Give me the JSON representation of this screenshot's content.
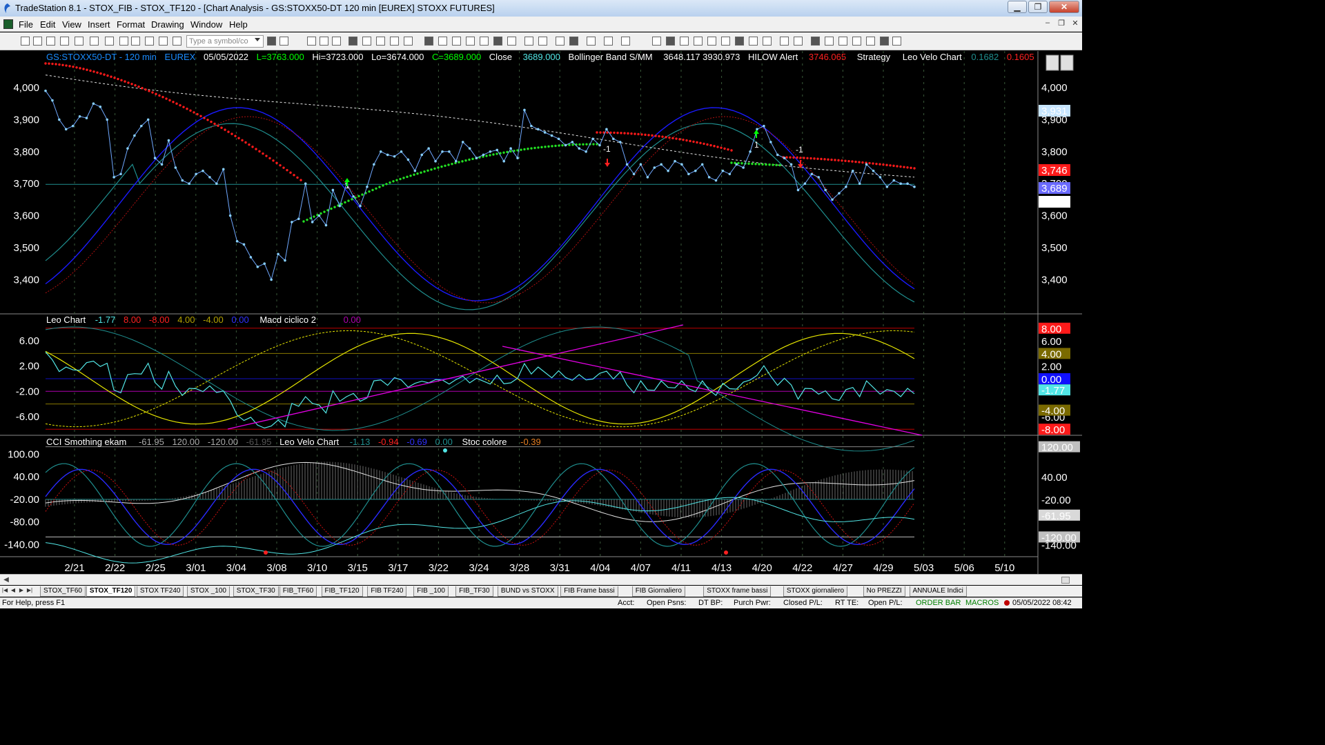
{
  "window": {
    "title": "TradeStation 8.1 - STOX_FIB - STOX_TF120 - [Chart Analysis - GS:STOXX50-DT  120 min  [EUREX] STOXX FUTURES]"
  },
  "menu": {
    "items": [
      "File",
      "Edit",
      "View",
      "Insert",
      "Format",
      "Drawing",
      "Window",
      "Help"
    ]
  },
  "toolbar": {
    "symbol_placeholder": "Type a symbol/co"
  },
  "header": {
    "symbol": "GS:STOXX50-DT - 120 min",
    "exchange": "EUREX",
    "date": "05/05/2022",
    "low_lbl": "L=3763.000",
    "hi": "Hi=3723.000",
    "lo": "Lo=3674.000",
    "close_val": "C=3689.000",
    "close_word": "Close",
    "close_num": "3689.000",
    "bb_name": "Bollinger Band S/MM",
    "bb_vals": "3648.117  3930.973",
    "hilow_name": "HILOW Alert",
    "hilow_val": "3746.065",
    "strategy": "Strategy",
    "leo_velo": "Leo Velo Chart",
    "lv1": "0.1682",
    "lv2": "0.1605"
  },
  "panel2": {
    "name": "Leo Chart",
    "v1": "-1.77",
    "v2": "8.00",
    "v3": "-8.00",
    "v4": "4.00",
    "v5": "-4.00",
    "v6": "0.00",
    "macd": "Macd ciclico 2",
    "macd_v": "0.00"
  },
  "panel3": {
    "name": "CCI Smothing ekam",
    "v1": "-61.95",
    "v2": "120.00",
    "v3": "-120.00",
    "v4": "-61.95",
    "velo": "Leo Velo Chart",
    "velo_v1": "-1.13",
    "velo_v2": "-0.94",
    "velo_v3": "-0.69",
    "velo_v4": "0.00",
    "stoc": "Stoc colore",
    "stoc_v": "-0.39"
  },
  "axis_labels": {
    "price": [
      "4,000",
      "3,900",
      "3,800",
      "3,700",
      "3,600",
      "3,500",
      "3,400"
    ],
    "price_right": [
      "4,000",
      "3,900",
      "3,800",
      "3,700",
      "3,600",
      "3,500",
      "3,400"
    ],
    "price_badges": [
      "3,931",
      "3,746",
      "3,689",
      "3,648"
    ],
    "osc": [
      "6.00",
      "2.00",
      "-2.00",
      "-6.00"
    ],
    "osc_right": [
      "6.00",
      "2.00",
      "-6.00"
    ],
    "osc_badges": [
      "8.00",
      "4.00",
      "0.00",
      "-1.77",
      "-4.00",
      "-8.00"
    ],
    "cci": [
      "100.00",
      "40.00",
      "-20.00",
      "-80.00",
      "-140.00"
    ],
    "cci_right": [
      "40.00",
      "-20.00",
      "-140.00"
    ],
    "cci_badges": [
      "120.00",
      "-61.95",
      "-120.00"
    ],
    "dates": [
      "2/21",
      "2/22",
      "2/25",
      "3/01",
      "3/04",
      "3/08",
      "3/10",
      "3/15",
      "3/17",
      "3/22",
      "3/24",
      "3/28",
      "3/31",
      "4/04",
      "4/07",
      "4/11",
      "4/13",
      "4/20",
      "4/22",
      "4/27",
      "4/29",
      "5/03",
      "5/06",
      "5/10"
    ]
  },
  "annotations": {
    "buy1": "1",
    "buy2": "1",
    "sell1": "-1",
    "sell2": "-1"
  },
  "price_series": [
    3990,
    3960,
    3900,
    3870,
    3880,
    3910,
    3905,
    3950,
    3940,
    3900,
    3720,
    3730,
    3810,
    3850,
    3880,
    3900,
    3780,
    3760,
    3835,
    3750,
    3710,
    3700,
    3730,
    3740,
    3720,
    3700,
    3745,
    3600,
    3520,
    3510,
    3470,
    3440,
    3450,
    3400,
    3480,
    3460,
    3580,
    3590,
    3700,
    3580,
    3600,
    3570,
    3680,
    3630,
    3700,
    3660,
    3630,
    3690,
    3760,
    3800,
    3790,
    3785,
    3800,
    3775,
    3740,
    3790,
    3810,
    3770,
    3800,
    3800,
    3770,
    3830,
    3810,
    3780,
    3790,
    3800,
    3805,
    3770,
    3810,
    3780,
    3930,
    3880,
    3870,
    3860,
    3850,
    3840,
    3820,
    3830,
    3810,
    3800,
    3840,
    3820,
    3870,
    3840,
    3830,
    3760,
    3730,
    3760,
    3720,
    3750,
    3760,
    3740,
    3770,
    3760,
    3730,
    3740,
    3760,
    3720,
    3710,
    3740,
    3730,
    3760,
    3750,
    3800,
    3870,
    3880,
    3830,
    3790,
    3780,
    3760,
    3680,
    3700,
    3730,
    3720,
    3680,
    3650,
    3670,
    3690,
    3740,
    3700,
    3760,
    3740,
    3720,
    3690,
    3710,
    3700,
    3700,
    3690
  ],
  "colors": {
    "price": "#87cefa",
    "bb_mid": "#e6e6e6",
    "bb_band": "#1a1aff",
    "trail_red": "#ff1a1a",
    "trail_green": "#22e022",
    "leo": "#52e6e6",
    "macd1": "#e6e600",
    "macd2": "#e6e600",
    "trendline": "#e600e6",
    "cci_teal": "#1f8f8f"
  },
  "tabs": [
    "STOX_TF60",
    "STOX_TF120",
    "STOX TF240",
    "STOX _100",
    "STOX_TF30",
    "FIB_TF60",
    "FIB_TF120",
    "FIB TF240",
    "FIB _100",
    "FIB_TF30",
    "BUND vs STOXX",
    "FIB Frame bassi",
    "FIB Giornaliero",
    "STOXX frame bassi",
    "STOXX giornaliero",
    "No PREZZI",
    "ANNUALE Indici"
  ],
  "status": {
    "help": "For Help, press F1",
    "acct": "Acct:",
    "open_psns": "Open Psns:",
    "dt_bp": "DT BP:",
    "purch_pwr": "Purch Pwr:",
    "closed_pl": "Closed P/L:",
    "rt_te": "RT TE:",
    "open_pl": "Open P/L:",
    "order_bar": "ORDER BAR",
    "macros": "MACROS",
    "datetime": "05/05/2022 08:42"
  }
}
